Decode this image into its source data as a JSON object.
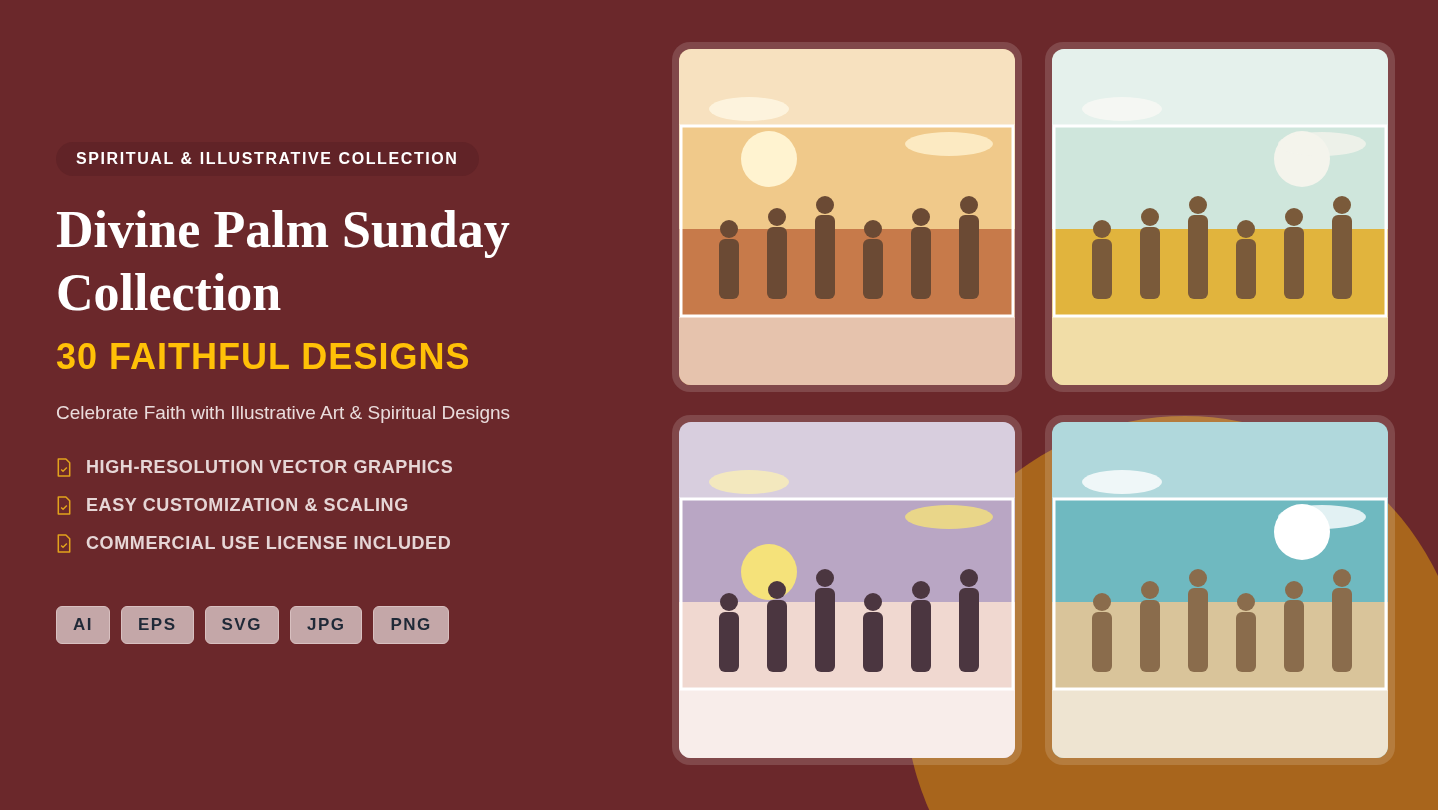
{
  "badge": "SPIRITUAL & ILLUSTRATIVE COLLECTION",
  "title": "Divine Palm Sunday Collection",
  "highlight": "30 FAITHFUL DESIGNS",
  "subtitle": "Celebrate Faith with Illustrative Art & Spiritual Designs",
  "features": [
    "HIGH-RESOLUTION VECTOR GRAPHICS",
    "EASY CUSTOMIZATION & SCALING",
    "COMMERCIAL USE LICENSE INCLUDED"
  ],
  "formats": [
    "AI",
    "EPS",
    "SVG",
    "JPG",
    "PNG"
  ],
  "previews": [
    {
      "kind": "picture"
    },
    {
      "kind": "picture"
    },
    {
      "kind": "picture"
    },
    {
      "kind": "picture"
    }
  ]
}
